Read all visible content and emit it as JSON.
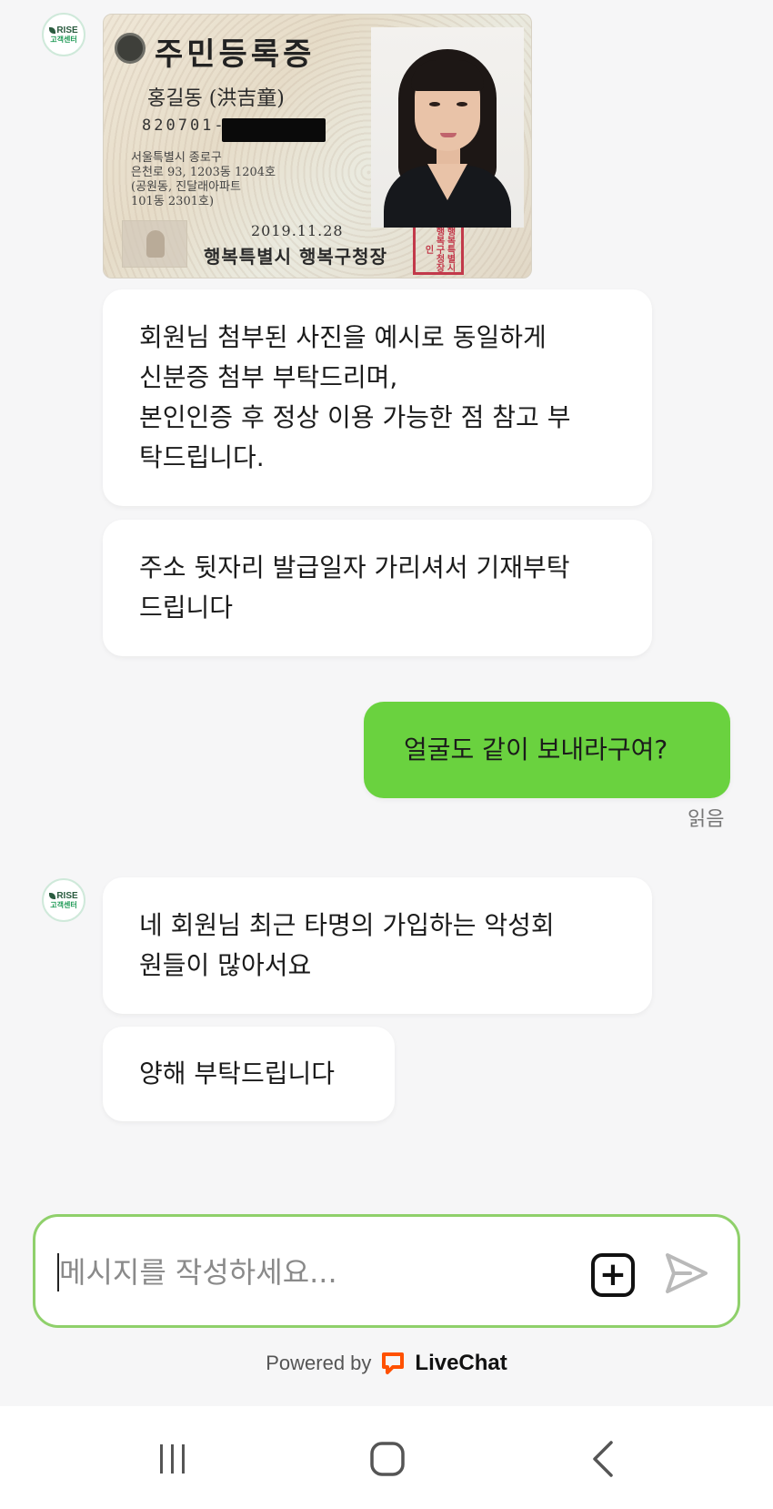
{
  "agent": {
    "avatar_line1": "RISE",
    "avatar_line2": "고객센터"
  },
  "id_card": {
    "title": "주민등록증",
    "name": "홍길동 (洪吉童)",
    "rrn_prefix": "820701-",
    "address_lines": [
      "서울특별시 종로구",
      "은천로 93, 1203동 1204호",
      "(공원동, 진달래아파트",
      "101동 2301호)"
    ],
    "issue_date": "2019.11.28",
    "issuer": "행복특별시 행복구청장",
    "seal_text": "행복특별시 행복구청장인"
  },
  "messages": [
    {
      "sender": "agent",
      "lines": [
        "회원님 첨부된 사진을 예시로 동일하게",
        "신분증 첨부 부탁드리며,",
        "본인인증 후 정상 이용 가능한 점 참고 부",
        "탁드립니다."
      ]
    },
    {
      "sender": "agent",
      "lines": [
        "주소 뒷자리 발급일자 가리셔서 기재부탁",
        "드립니다"
      ]
    },
    {
      "sender": "user",
      "lines": [
        "얼굴도 같이 보내라구여?"
      ],
      "status": "읽음"
    },
    {
      "sender": "agent",
      "lines": [
        "네 회원님 최근 타명의 가입하는 악성회",
        "원들이 많아서요"
      ]
    },
    {
      "sender": "agent",
      "lines": [
        "양해 부탁드립니다"
      ]
    }
  ],
  "composer": {
    "placeholder": "메시지를 작성하세요...",
    "add_symbol": "+",
    "accent_color": "#8fd06b"
  },
  "footer": {
    "powered_by": "Powered by",
    "brand": "LiveChat",
    "brand_color": "#ff5100"
  },
  "colors": {
    "user_bubble": "#6ad23f",
    "agent_bubble": "#ffffff",
    "background": "#f6f6f7"
  }
}
